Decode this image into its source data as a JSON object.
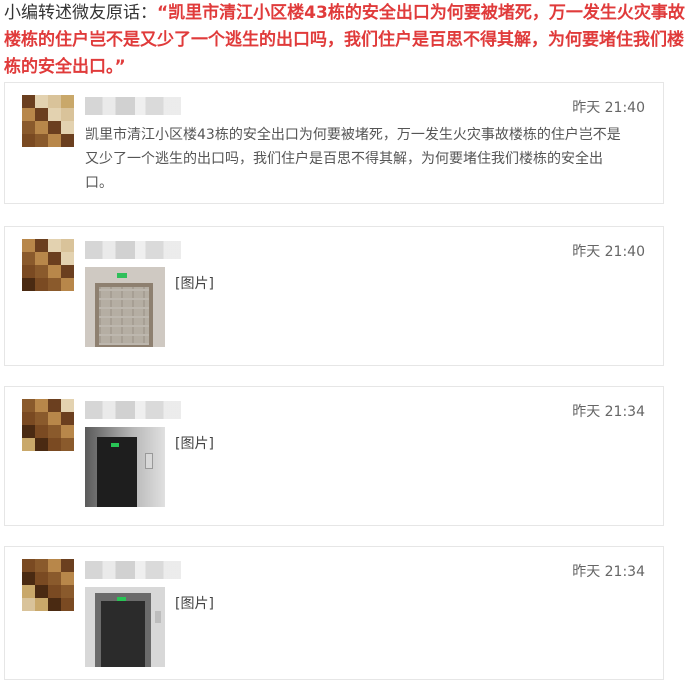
{
  "intro": {
    "prefix": "小编转述微友原话：",
    "quote": "“凯里市清江小区楼43栋的安全出口为何要被堵死，万一发生火灾事故楼栋的住户岂不是又少了一个逃生的出口吗，我们住户是百思不得其解，为何要堵住我们楼栋的安全出口。”"
  },
  "messages": [
    {
      "time": "昨天 21:40",
      "text": "凯里市清江小区楼43栋的安全出口为何要被堵死，万一发生火灾事故楼栋的住户岂不是又少了一个逃生的出口吗，我们住户是百思不得其解，为何要堵住我们楼栋的安全出口。"
    },
    {
      "time": "昨天 21:40",
      "image_label": "[图片]"
    },
    {
      "time": "昨天 21:34",
      "image_label": "[图片]"
    },
    {
      "time": "昨天 21:34",
      "image_label": "[图片]"
    }
  ],
  "colors": {
    "quote_red": "#e03b3b",
    "timestamp_gray": "#666666",
    "card_border": "#e6e6e6"
  }
}
